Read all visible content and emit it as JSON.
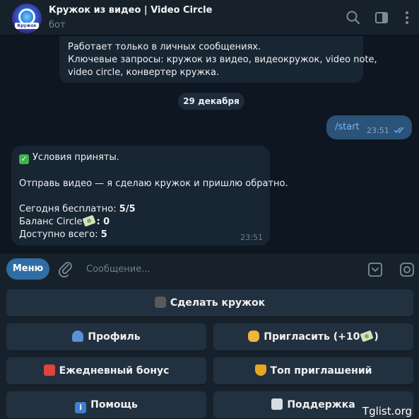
{
  "header": {
    "title": "Кружок из видео | Video Circle",
    "subtitle": "бот",
    "avatar_text": "Кружок из видео",
    "icons": [
      "search-icon",
      "sidebar-toggle-icon",
      "more-vert-icon"
    ]
  },
  "messages": {
    "top_lines": [
      "Работает только в личных сообщениях.",
      "Ключевые запросы: кружок из видео, видеокружок, video note,",
      "video circle, конвертер кружка."
    ],
    "date": "29 декабря",
    "outgoing": {
      "text": "/start",
      "time": "23:51"
    },
    "incoming": {
      "line1": "Условия приняты.",
      "line2": "Отправь видео — я сделаю кружок и пришлю обратно.",
      "today_label": "Сегодня бесплатно: ",
      "today_value": "5/5",
      "balance_label": "Баланс Circle",
      "balance_value": ": 0",
      "total_label": "Доступно всего: ",
      "total_value": "5",
      "time": "23:51"
    }
  },
  "composer": {
    "menu_label": "Меню",
    "placeholder": "Сообщение..."
  },
  "keyboard": {
    "make_circle": "Сделать кружок",
    "profile": "Профиль",
    "invite": "Пригласить (+10",
    "invite_suffix": ")",
    "daily_bonus": "Ежедневный бонус",
    "top_invites": "Топ приглашений",
    "help": "Помощь",
    "support": "Поддержка"
  },
  "watermark": "Tglist.org",
  "colors": {
    "background": "#0e1621",
    "panel": "#17212b",
    "incoming_bubble": "#182533",
    "outgoing_bubble": "#2b5278",
    "accent": "#2f6ea5",
    "key_button": "#223140"
  }
}
